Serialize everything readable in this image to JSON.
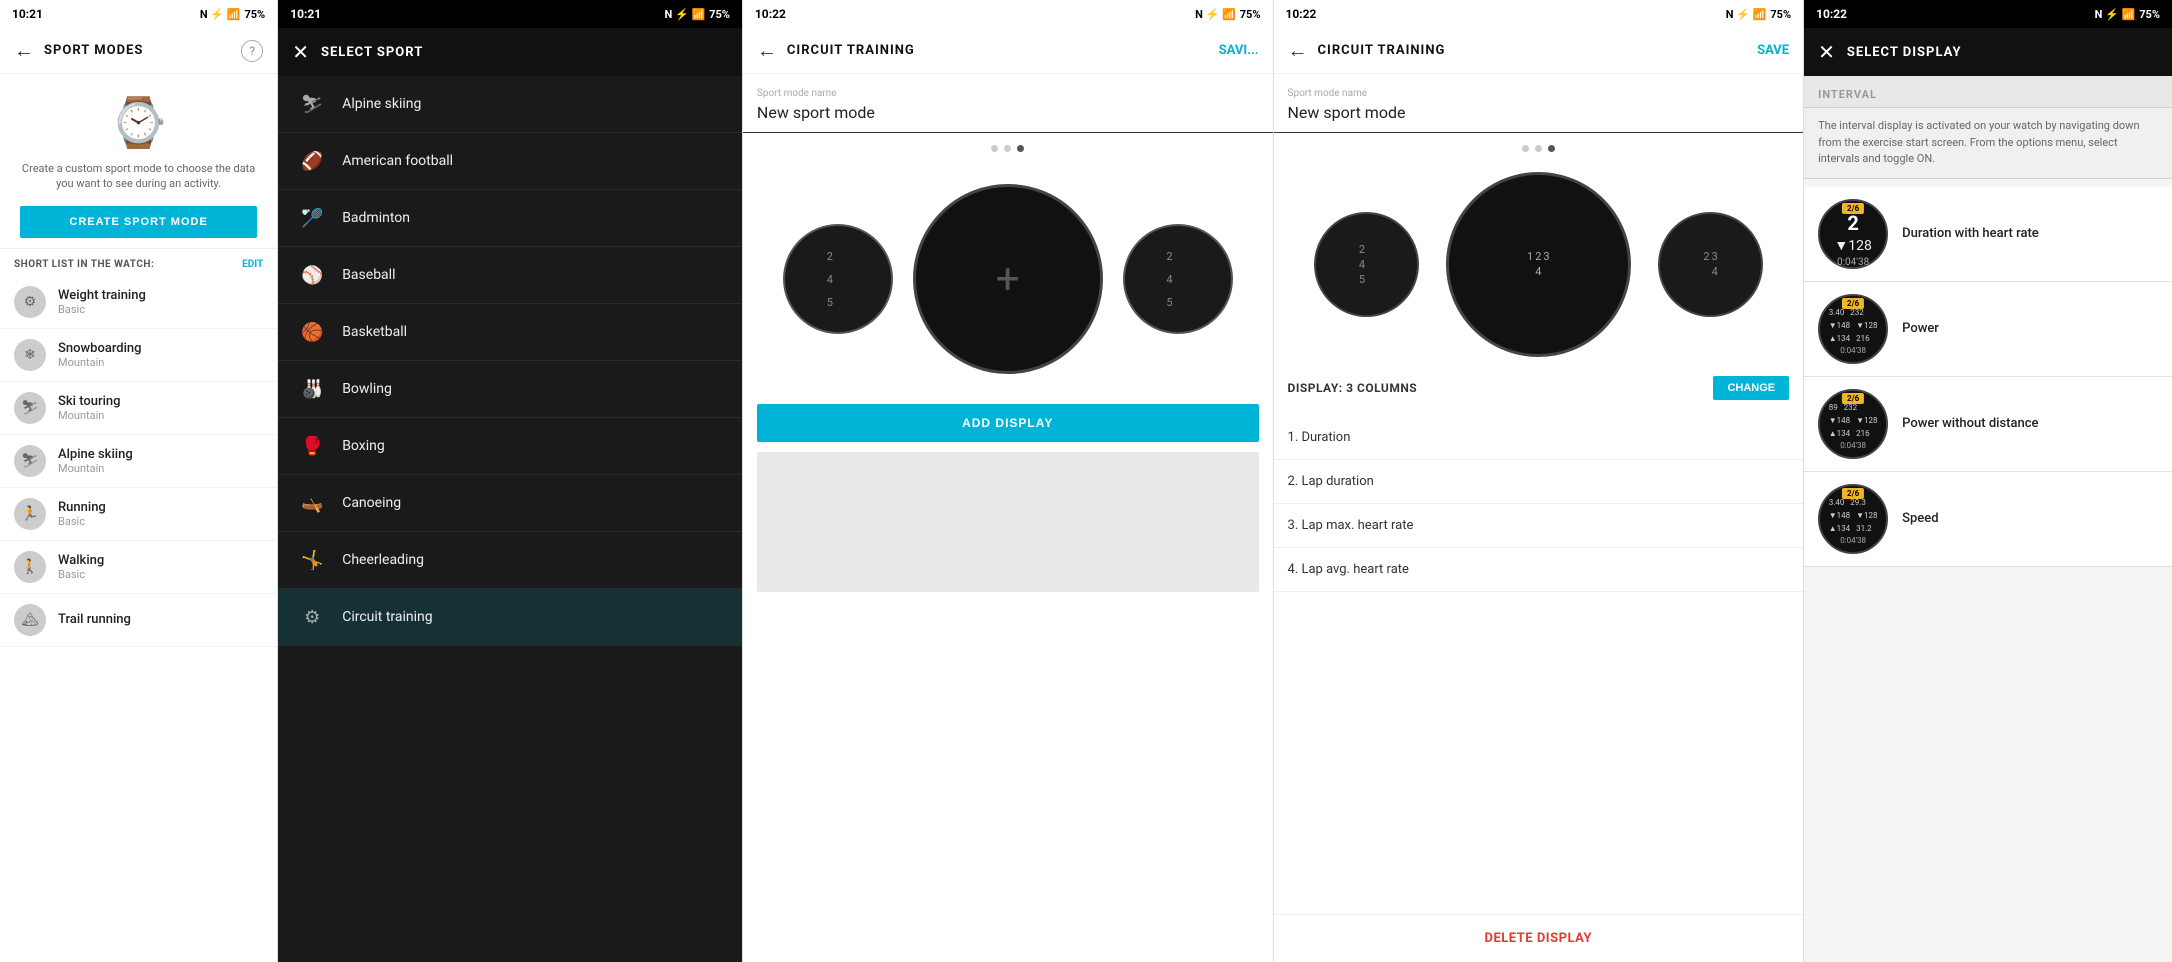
{
  "panel1": {
    "status": {
      "time": "10:21",
      "battery": "75%"
    },
    "header": {
      "title": "SPORT MODES",
      "help": "?"
    },
    "hero": {
      "desc": "Create a custom sport mode to choose the data you want to see during an activity.",
      "create_btn": "CREATE SPORT MODE"
    },
    "shortlist": {
      "label": "SHORT LIST IN THE WATCH:",
      "edit": "EDIT",
      "items": [
        {
          "name": "Weight training",
          "sub": "Basic",
          "icon": "⚙"
        },
        {
          "name": "Snowboarding",
          "sub": "Mountain",
          "icon": "❄"
        },
        {
          "name": "Ski touring",
          "sub": "Mountain",
          "icon": "⛷"
        },
        {
          "name": "Alpine skiing",
          "sub": "Mountain",
          "icon": "⛷"
        },
        {
          "name": "Running",
          "sub": "Basic",
          "icon": "🏃"
        },
        {
          "name": "Walking",
          "sub": "Basic",
          "icon": "🚶"
        },
        {
          "name": "Trail running",
          "sub": "",
          "icon": "🏔"
        }
      ]
    }
  },
  "panel2": {
    "status": {
      "time": "10:21",
      "battery": "75%"
    },
    "header": {
      "title": "SELECT SPORT"
    },
    "items": [
      {
        "label": "Alpine skiing",
        "icon": "⛷"
      },
      {
        "label": "American football",
        "icon": "🏈"
      },
      {
        "label": "Badminton",
        "icon": "🏸"
      },
      {
        "label": "Baseball",
        "icon": "⚾"
      },
      {
        "label": "Basketball",
        "icon": "🏀"
      },
      {
        "label": "Bowling",
        "icon": "🎳"
      },
      {
        "label": "Boxing",
        "icon": "🥊"
      },
      {
        "label": "Canoeing",
        "icon": "🛶"
      },
      {
        "label": "Cheerleading",
        "icon": "🤸"
      },
      {
        "label": "Circuit training",
        "icon": "⚙"
      }
    ]
  },
  "panel3": {
    "status": {
      "time": "10:22",
      "battery": "75%"
    },
    "header": {
      "title": "CIRCUIT TRAINING",
      "save": "SAVI..."
    },
    "mode_label": "Sport mode name",
    "mode_name": "New sport mode",
    "add_display_btn": "ADD DISPLAY",
    "dots": [
      false,
      false,
      true
    ]
  },
  "panel4": {
    "status": {
      "time": "10:22",
      "battery": "75%"
    },
    "header": {
      "title": "CIRCUIT TRAINING",
      "save": "SAVE"
    },
    "mode_label": "Sport mode name",
    "mode_name": "New sport mode",
    "display_label": "DISPLAY: 3 COLUMNS",
    "change_btn": "CHANGE",
    "items": [
      "1. Duration",
      "2. Lap duration",
      "3. Lap max. heart rate",
      "4. Lap avg. heart rate"
    ],
    "delete_btn": "DELETE DISPLAY",
    "dots": [
      false,
      false,
      true
    ]
  },
  "panel5": {
    "status": {
      "time": "10:22",
      "battery": "75%"
    },
    "header": {
      "title": "SELECT DISPLAY"
    },
    "interval_label": "INTERVAL",
    "interval_desc": "The interval display is activated on your watch by navigating down from the exercise start screen. From the options menu, select intervals and toggle ON.",
    "options": [
      {
        "label": "Duration with heart rate",
        "badge": "2/6",
        "data1": "2",
        "data2": "128",
        "data3": "0:04'38"
      },
      {
        "label": "Power",
        "badge": "2/6",
        "data1": "3.40",
        "data2": "232",
        "data3": "0:04'38"
      },
      {
        "label": "Power without distance",
        "badge": "2/6",
        "data1": "89",
        "data2": "232",
        "data3": "0:04'38"
      },
      {
        "label": "Speed",
        "badge": "2/6",
        "data1": "3.40",
        "data2": "29.3",
        "data3": "0:04'38"
      }
    ]
  }
}
